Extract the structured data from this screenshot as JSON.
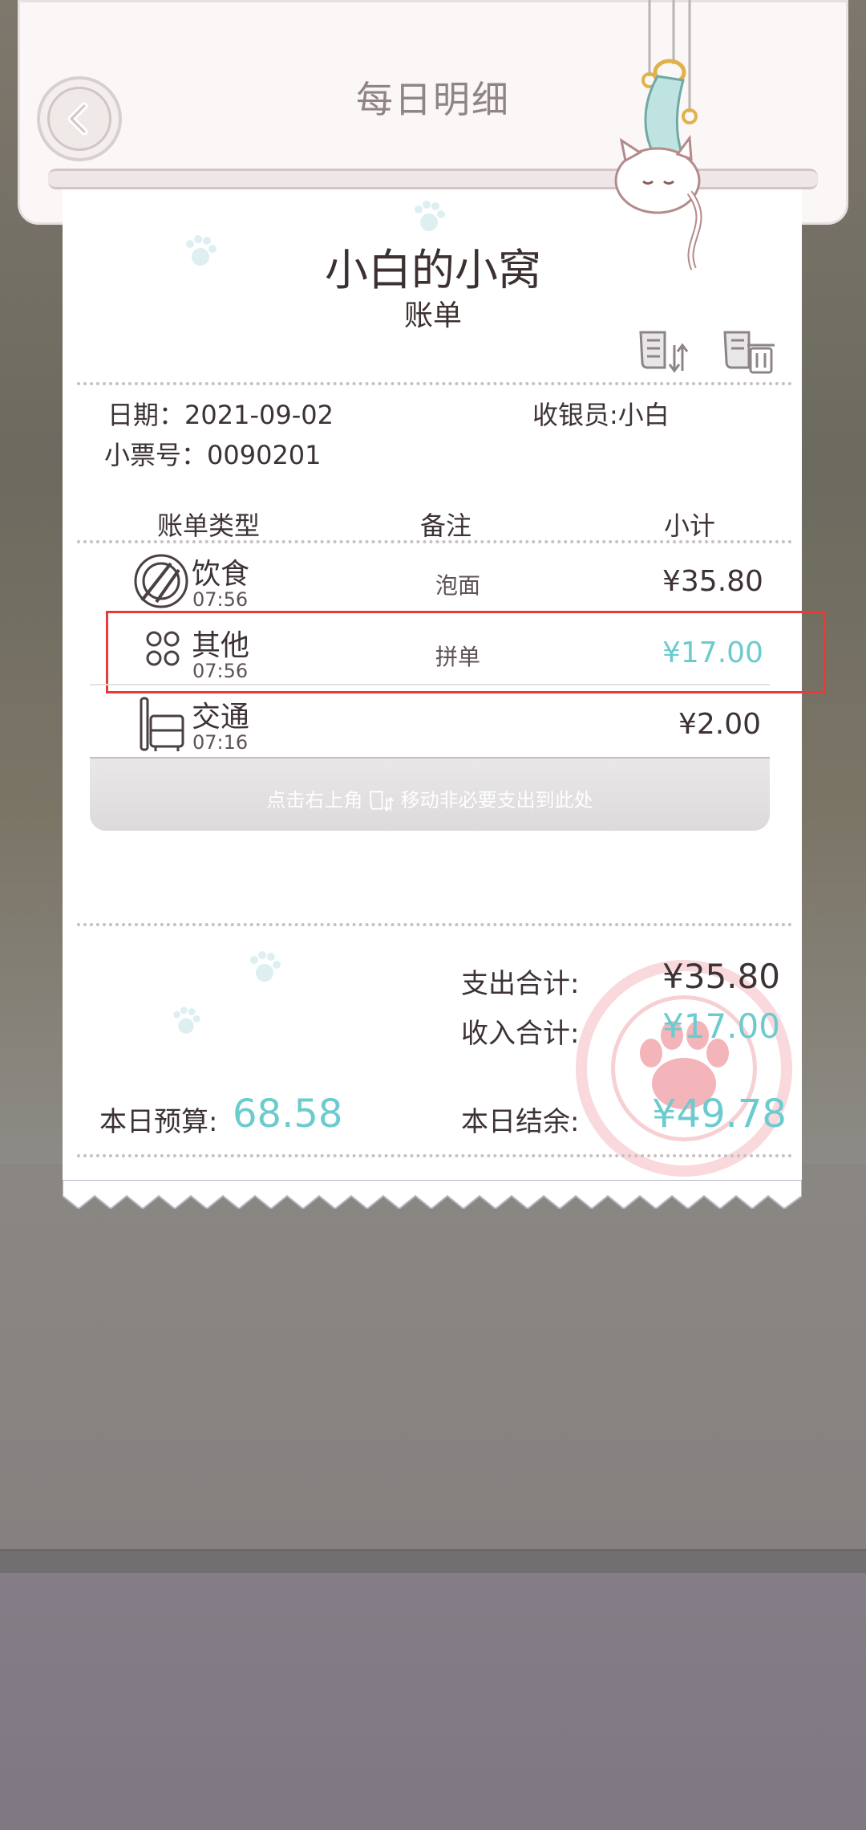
{
  "header": {
    "title": "每日明细"
  },
  "receipt": {
    "store_name": "小白的小窝",
    "type_label": "账单",
    "date_label": "日期：2021-09-02",
    "cashier_label": "收银员:小白",
    "ticket_label": "小票号：0090201",
    "columns": [
      "账单类型",
      "备注",
      "小计"
    ],
    "rows": [
      {
        "category": "饮食",
        "time": "07:56",
        "note": "泡面",
        "amount": "¥35.80",
        "icon": "food-icon"
      },
      {
        "category": "其他",
        "time": "07:56",
        "note": "拼单",
        "amount": "¥17.00",
        "icon": "other-icon"
      },
      {
        "category": "交通",
        "time": "07:16",
        "note": "",
        "amount": "¥2.00",
        "icon": "transport-icon"
      }
    ],
    "hint": {
      "before": "点击右上角",
      "after": "移动非必要支出到此处"
    },
    "totals": {
      "expense_label": "支出合计:",
      "expense_value": "¥35.80",
      "income_label": "收入合计:",
      "income_value": "¥17.00",
      "budget_label": "本日预算:",
      "budget_value": "68.58",
      "balance_label": "本日结余:",
      "balance_value": "¥49.78"
    }
  },
  "colors": {
    "accent": "#6ccbcf",
    "text": "#3d3234",
    "highlight": "#e53b3b",
    "stamp": "#e97882"
  }
}
